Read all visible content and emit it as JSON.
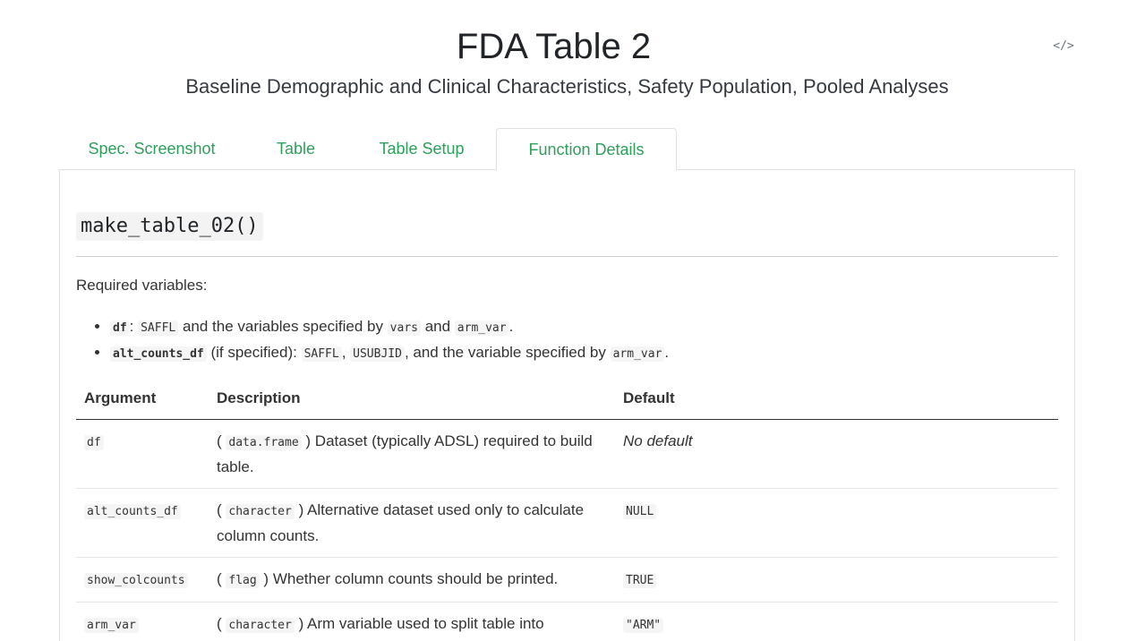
{
  "header": {
    "title": "FDA Table 2",
    "subtitle": "Baseline Demographic and Clinical Characteristics, Safety Population, Pooled Analyses",
    "code_icon": "code-icon",
    "code_glyph": "</>"
  },
  "tabs": [
    {
      "label": "Spec. Screenshot",
      "active": false
    },
    {
      "label": "Table",
      "active": false
    },
    {
      "label": "Table Setup",
      "active": false
    },
    {
      "label": "Function Details",
      "active": true
    }
  ],
  "function": {
    "name": "make_table_02()",
    "required_label": "Required variables:",
    "requirements": [
      {
        "arg": "df",
        "sep": ": ",
        "v1": "SAFFL",
        "t1": " and the variables specified by ",
        "v2": "vars",
        "t2": " and ",
        "v3": "arm_var",
        "t3": "."
      },
      {
        "arg": "alt_counts_df",
        "sep": " (if specified): ",
        "v1": "SAFFL",
        "t1": ", ",
        "v2": "USUBJID",
        "t2": ", and the variable specified by ",
        "v3": "arm_var",
        "t3": "."
      }
    ]
  },
  "table": {
    "headers": [
      "Argument",
      "Description",
      "Default"
    ],
    "rows": [
      {
        "arg": "df",
        "type": "data.frame",
        "desc": " Dataset (typically ADSL) required to build table.",
        "default": "No default",
        "default_italic": true
      },
      {
        "arg": "alt_counts_df",
        "type": "character",
        "desc": " Alternative dataset used only to calculate column counts.",
        "default": "NULL",
        "default_italic": false
      },
      {
        "arg": "show_colcounts",
        "type": "flag",
        "desc": " Whether column counts should be printed.",
        "default": "TRUE",
        "default_italic": false
      },
      {
        "arg": "arm_var",
        "type": "character",
        "desc": " Arm variable used to split table into columns.",
        "default": "\"ARM\"",
        "default_italic": false
      }
    ]
  }
}
